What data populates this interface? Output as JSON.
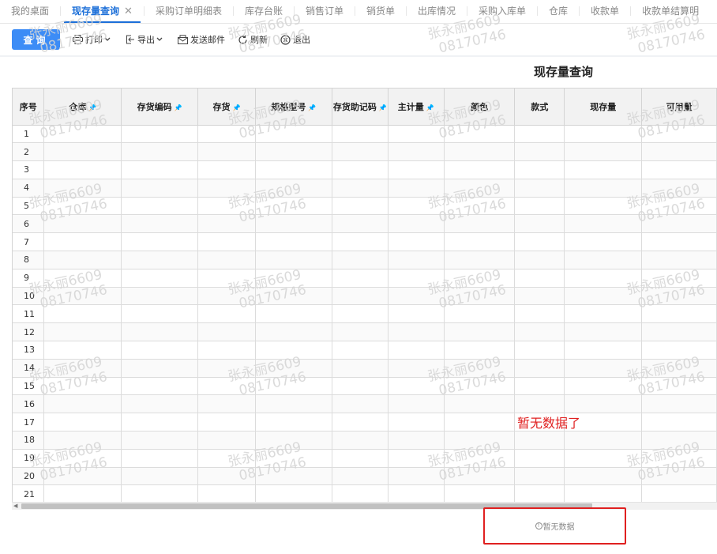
{
  "tabs": [
    {
      "label": "我的桌面"
    },
    {
      "label": "现存量查询",
      "active": true
    },
    {
      "label": "采购订单明细表"
    },
    {
      "label": "库存台账"
    },
    {
      "label": "销售订单"
    },
    {
      "label": "销货单"
    },
    {
      "label": "出库情况"
    },
    {
      "label": "采购入库单"
    },
    {
      "label": "仓库"
    },
    {
      "label": "收款单"
    },
    {
      "label": "收款单结算明"
    }
  ],
  "tab_close": "✕",
  "toolbar": {
    "query": "查询",
    "print": "打印",
    "export": "导出",
    "email": "发送邮件",
    "refresh": "刷新",
    "exit": "退出"
  },
  "page_title": "现存量查询",
  "table": {
    "columns": [
      {
        "label": "序号",
        "pin": false
      },
      {
        "label": "仓库",
        "pin": true
      },
      {
        "label": "存货编码",
        "pin": true
      },
      {
        "label": "存货",
        "pin": true
      },
      {
        "label": "规格型号",
        "pin": true
      },
      {
        "label": "存货助记码",
        "pin": true
      },
      {
        "label": "主计量",
        "pin": true
      },
      {
        "label": "颜色",
        "pin": false
      },
      {
        "label": "款式",
        "pin": false
      },
      {
        "label": "现存量",
        "pin": false
      },
      {
        "label": "可用量",
        "pin": false
      }
    ],
    "rows": [
      "1",
      "2",
      "3",
      "4",
      "5",
      "6",
      "7",
      "8",
      "9",
      "10",
      "11",
      "12",
      "13",
      "14",
      "15",
      "16",
      "17",
      "18",
      "19",
      "20",
      "21"
    ]
  },
  "no_data_annotation": "暂无数据了",
  "empty_text": "暂无数据",
  "empty_icon": "!",
  "watermark": {
    "name": "张永丽6609",
    "id": "08170746"
  },
  "colors": {
    "primary": "#3c8cf6",
    "tab_active": "#1c6fd8",
    "annotation_red": "#e02020"
  }
}
